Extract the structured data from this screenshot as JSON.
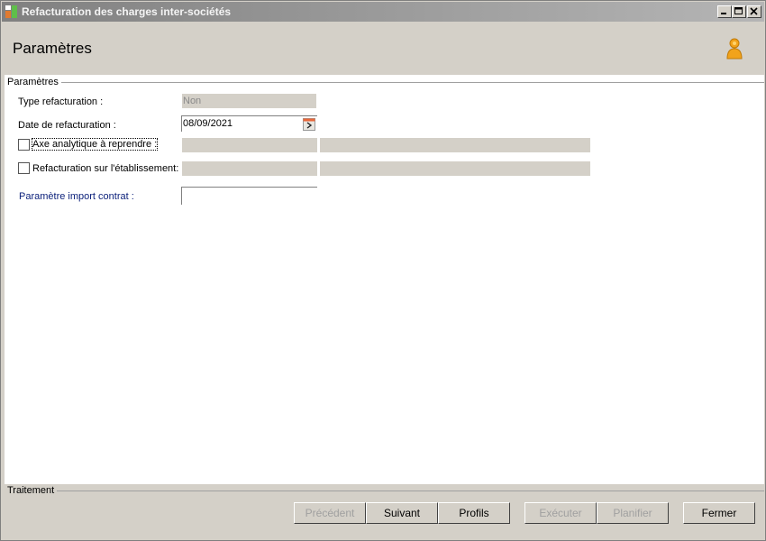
{
  "window": {
    "title": "Refacturation des charges inter-sociétés"
  },
  "header": {
    "page_title": "Paramètres"
  },
  "params_section": {
    "label": "Paramètres",
    "type_refacturation": {
      "label": "Type refacturation :",
      "value": "Non"
    },
    "date_refacturation": {
      "label": "Date de refacturation :",
      "value": "08/09/2021"
    },
    "axe_analytique": {
      "label": "Axe analytique à reprendre :",
      "checked": false,
      "code": "",
      "description": ""
    },
    "refacturation_etablissement": {
      "label": "Refacturation sur l'établissement:",
      "checked": false,
      "code": "",
      "description": ""
    },
    "parametre_import": {
      "label": "Paramètre import contrat :",
      "value": ""
    }
  },
  "footer": {
    "label": "Traitement",
    "buttons": {
      "precedent": "Précédent",
      "suivant": "Suivant",
      "profils": "Profils",
      "executer": "Exécuter",
      "planifier": "Planifier",
      "fermer": "Fermer"
    }
  },
  "colors": {
    "chrome": "#d4d0c8",
    "title_gradient_start": "#808080",
    "title_gradient_end": "#b5b5b5",
    "link_label": "#0a1f7a",
    "disabled_text": "#a0a0a0"
  }
}
